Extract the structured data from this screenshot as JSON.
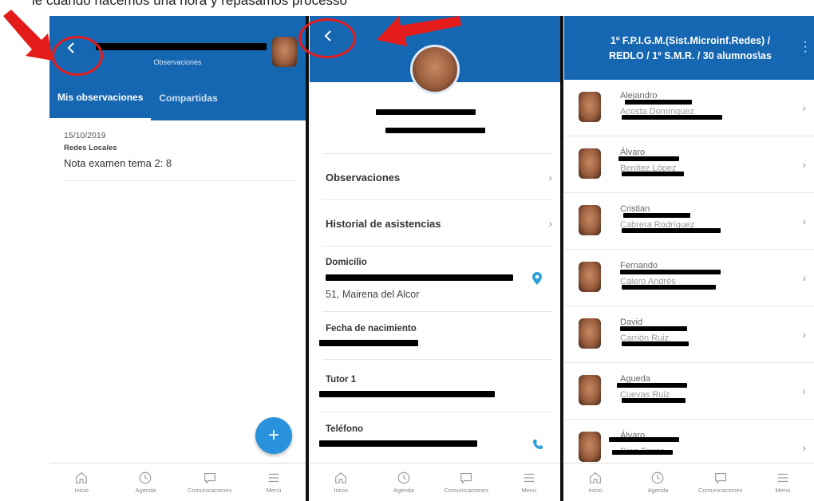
{
  "caption": "le cuando hacemos una hora y repasamos processo",
  "panel1": {
    "header_subtitle": "Observaciones",
    "tabs": [
      "Mis observaciones",
      "Compartidas"
    ],
    "observation": {
      "date": "15/10/2019",
      "subject": "Redes Locales",
      "note": "Nota examen tema 2: 8"
    },
    "fab_label": "+"
  },
  "panel2": {
    "items": [
      "Observaciones",
      "Historial de asistencias"
    ],
    "domicilio": {
      "label": "Domicilio",
      "value_line2": "51, Mairena del Alcor"
    },
    "fecha": {
      "label": "Fecha de nacimiento"
    },
    "tutor": {
      "label": "Tutor 1"
    },
    "telefono": {
      "label": "Teléfono"
    }
  },
  "panel3": {
    "title_line1": "1º F.P.I.G.M.(Sist.Microinf.Redes) /",
    "title_line2": "REDLO / 1º  S.M.R. / 30 alumnos\\as",
    "students": [
      {
        "first": "Alejandro",
        "last": "Acosta Domínguez"
      },
      {
        "first": "Álvaro",
        "last": "Benítez López"
      },
      {
        "first": "Cristian",
        "last": "Cabrera Rodríguez"
      },
      {
        "first": "Fernando",
        "last": "Calero Andrés"
      },
      {
        "first": "David",
        "last": "Carrión Ruiz"
      },
      {
        "first": "Agueda",
        "last": "Cuevas Ruiz"
      },
      {
        "first": "Álvaro",
        "last": "Díaz Torres"
      }
    ]
  },
  "nav": [
    "Inicio",
    "Agenda",
    "Comunicaciones",
    "Menú"
  ],
  "colors": {
    "header_blue": "#1567b2",
    "fab_blue": "#2893dc",
    "annotation_red": "#e31b1b"
  },
  "icons": [
    "back-chevron-icon",
    "chevron-right-icon",
    "location-pin-icon",
    "phone-icon",
    "home-icon",
    "clock-icon",
    "chat-icon",
    "menu-icon",
    "kebab-icon"
  ]
}
